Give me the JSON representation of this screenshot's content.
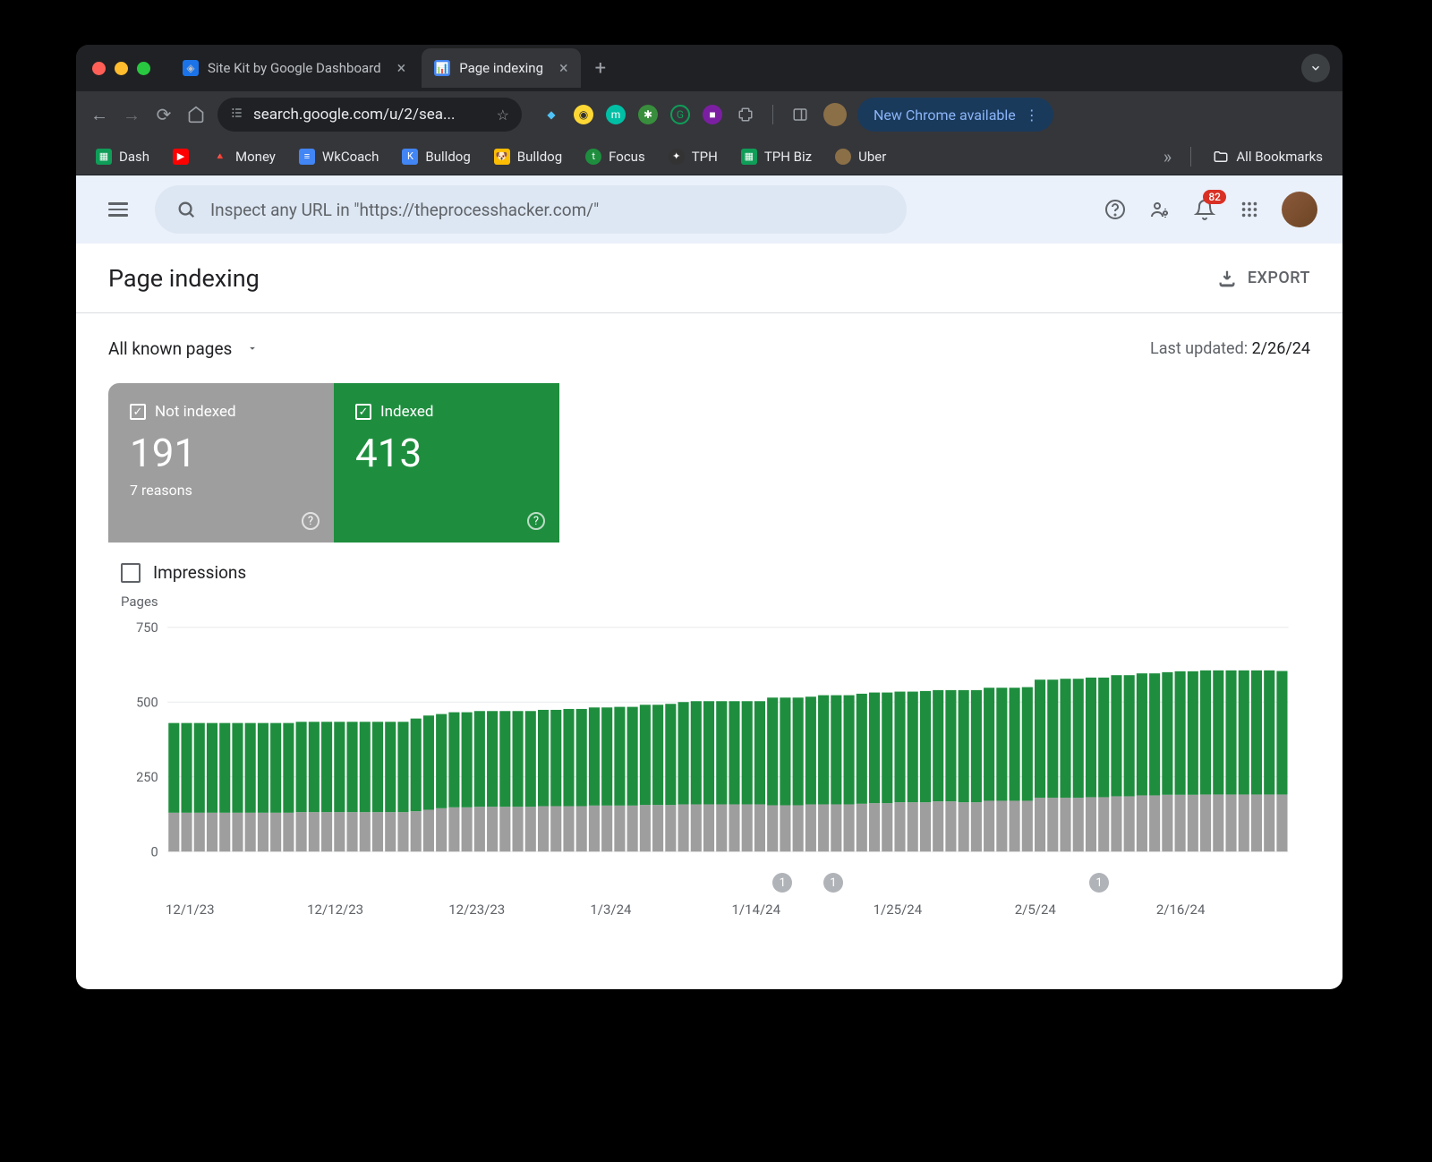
{
  "browser": {
    "tabs": [
      {
        "title": "Site Kit by Google Dashboard",
        "active": false
      },
      {
        "title": "Page indexing",
        "active": true
      }
    ],
    "url": "search.google.com/u/2/sea...",
    "update_label": "New Chrome available",
    "bookmarks": [
      {
        "label": "Dash",
        "color": "#0f9d58"
      },
      {
        "label": "",
        "color": "#ff0000"
      },
      {
        "label": "Money",
        "color": "#fbbc04"
      },
      {
        "label": "WkCoach",
        "color": "#4285f4"
      },
      {
        "label": "Bulldog",
        "color": "#4285f4"
      },
      {
        "label": "Bulldog",
        "color": "#fbbc04"
      },
      {
        "label": "Focus",
        "color": "#1e8e3e"
      },
      {
        "label": "TPH",
        "color": "#5f6368"
      },
      {
        "label": "TPH Biz",
        "color": "#0f9d58"
      },
      {
        "label": "Uber",
        "color": "#8b6f47"
      }
    ],
    "all_bookmarks": "All Bookmarks"
  },
  "gsc": {
    "search_placeholder": "Inspect any URL in \"https://theprocesshacker.com/\"",
    "notification_count": "82",
    "page_title": "Page indexing",
    "export_label": "EXPORT",
    "dropdown_label": "All known pages",
    "last_updated_prefix": "Last updated: ",
    "last_updated_date": "2/26/24",
    "cards": {
      "not_indexed": {
        "label": "Not indexed",
        "value": "191",
        "sub": "7 reasons"
      },
      "indexed": {
        "label": "Indexed",
        "value": "413"
      }
    },
    "impressions_label": "Impressions",
    "chart_ylabel": "Pages"
  },
  "chart_data": {
    "type": "bar",
    "ylabel": "Pages",
    "ylim": [
      0,
      750
    ],
    "yticks": [
      0,
      250,
      500,
      750
    ],
    "x_ticks": [
      "12/1/23",
      "12/12/23",
      "12/23/23",
      "1/3/24",
      "1/14/24",
      "1/25/24",
      "2/5/24",
      "2/16/24"
    ],
    "markers": [
      {
        "label": "1",
        "position": 0.55
      },
      {
        "label": "1",
        "position": 0.59
      },
      {
        "label": "1",
        "position": 0.8
      }
    ],
    "series": [
      {
        "name": "Not indexed",
        "color": "#9e9e9e",
        "values": [
          130,
          130,
          130,
          130,
          130,
          130,
          130,
          130,
          130,
          130,
          132,
          132,
          132,
          132,
          132,
          132,
          132,
          132,
          132,
          135,
          140,
          145,
          148,
          148,
          150,
          150,
          150,
          150,
          150,
          152,
          152,
          152,
          152,
          154,
          154,
          154,
          154,
          156,
          156,
          156,
          158,
          158,
          158,
          158,
          158,
          158,
          158,
          155,
          155,
          155,
          158,
          158,
          158,
          158,
          160,
          162,
          162,
          165,
          165,
          165,
          168,
          168,
          165,
          165,
          170,
          170,
          170,
          170,
          180,
          180,
          180,
          180,
          182,
          182,
          185,
          185,
          188,
          188,
          190,
          190,
          190,
          191,
          191,
          191,
          191,
          191,
          191,
          191
        ]
      },
      {
        "name": "Indexed",
        "color": "#1e8e3e",
        "values": [
          300,
          300,
          300,
          300,
          300,
          300,
          300,
          300,
          300,
          300,
          302,
          302,
          302,
          302,
          302,
          302,
          302,
          302,
          302,
          310,
          315,
          315,
          318,
          318,
          320,
          320,
          320,
          320,
          320,
          322,
          322,
          325,
          325,
          328,
          328,
          330,
          330,
          335,
          335,
          338,
          342,
          345,
          345,
          345,
          345,
          345,
          345,
          360,
          360,
          360,
          360,
          365,
          365,
          365,
          368,
          370,
          370,
          370,
          370,
          372,
          372,
          372,
          375,
          375,
          378,
          378,
          378,
          380,
          395,
          395,
          398,
          398,
          400,
          400,
          405,
          405,
          408,
          408,
          410,
          413,
          413,
          415,
          415,
          415,
          415,
          415,
          415,
          413
        ]
      }
    ]
  }
}
